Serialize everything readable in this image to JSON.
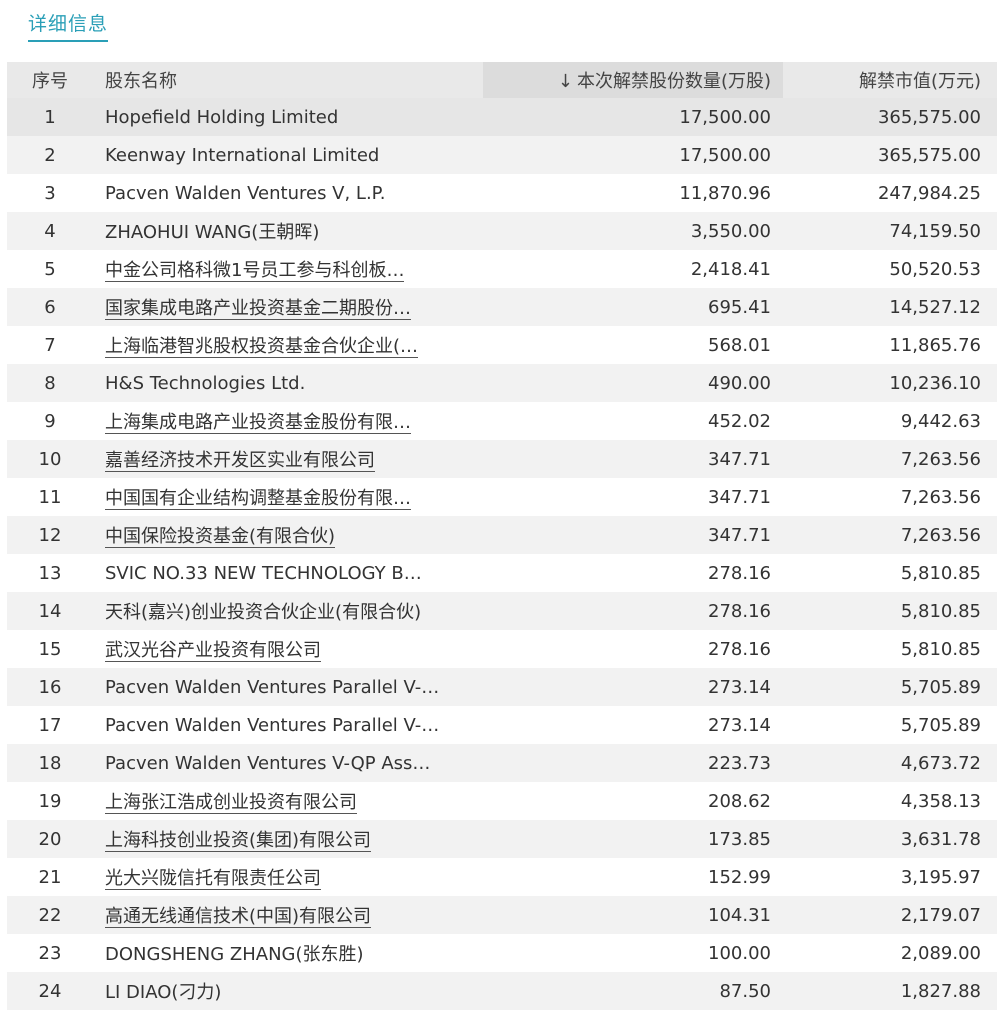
{
  "tab": {
    "label": "详细信息"
  },
  "table": {
    "headers": {
      "index": "序号",
      "holder": "股东名称",
      "sort_arrow": "↓",
      "shares": "本次解禁股份数量(万股)",
      "value": "解禁市值(万元)"
    },
    "rows": [
      {
        "idx": "1",
        "name": "Hopefield Holding Limited",
        "link": false,
        "shares": "17,500.00",
        "value": "365,575.00"
      },
      {
        "idx": "2",
        "name": "Keenway International Limited",
        "link": false,
        "shares": "17,500.00",
        "value": "365,575.00"
      },
      {
        "idx": "3",
        "name": "Pacven Walden Ventures V, L.P.",
        "link": false,
        "shares": "11,870.96",
        "value": "247,984.25"
      },
      {
        "idx": "4",
        "name": "ZHAOHUI WANG(王朝晖)",
        "link": false,
        "shares": "3,550.00",
        "value": "74,159.50"
      },
      {
        "idx": "5",
        "name": "中金公司格科微1号员工参与科创板…",
        "link": true,
        "shares": "2,418.41",
        "value": "50,520.53"
      },
      {
        "idx": "6",
        "name": "国家集成电路产业投资基金二期股份…",
        "link": true,
        "shares": "695.41",
        "value": "14,527.12"
      },
      {
        "idx": "7",
        "name": "上海临港智兆股权投资基金合伙企业(…",
        "link": true,
        "shares": "568.01",
        "value": "11,865.76"
      },
      {
        "idx": "8",
        "name": "H&S Technologies Ltd.",
        "link": false,
        "shares": "490.00",
        "value": "10,236.10"
      },
      {
        "idx": "9",
        "name": "上海集成电路产业投资基金股份有限…",
        "link": true,
        "shares": "452.02",
        "value": "9,442.63"
      },
      {
        "idx": "10",
        "name": "嘉善经济技术开发区实业有限公司",
        "link": true,
        "shares": "347.71",
        "value": "7,263.56"
      },
      {
        "idx": "11",
        "name": "中国国有企业结构调整基金股份有限…",
        "link": true,
        "shares": "347.71",
        "value": "7,263.56"
      },
      {
        "idx": "12",
        "name": "中国保险投资基金(有限合伙)",
        "link": true,
        "shares": "347.71",
        "value": "7,263.56"
      },
      {
        "idx": "13",
        "name": "SVIC NO.33 NEW TECHNOLOGY B…",
        "link": false,
        "shares": "278.16",
        "value": "5,810.85"
      },
      {
        "idx": "14",
        "name": "天科(嘉兴)创业投资合伙企业(有限合伙)",
        "link": false,
        "shares": "278.16",
        "value": "5,810.85"
      },
      {
        "idx": "15",
        "name": "武汉光谷产业投资有限公司",
        "link": true,
        "shares": "278.16",
        "value": "5,810.85"
      },
      {
        "idx": "16",
        "name": "Pacven Walden Ventures Parallel V-…",
        "link": false,
        "shares": "273.14",
        "value": "5,705.89"
      },
      {
        "idx": "17",
        "name": "Pacven Walden Ventures Parallel V-…",
        "link": false,
        "shares": "273.14",
        "value": "5,705.89"
      },
      {
        "idx": "18",
        "name": "Pacven Walden Ventures V-QP Ass…",
        "link": false,
        "shares": "223.73",
        "value": "4,673.72"
      },
      {
        "idx": "19",
        "name": "上海张江浩成创业投资有限公司",
        "link": true,
        "shares": "208.62",
        "value": "4,358.13"
      },
      {
        "idx": "20",
        "name": "上海科技创业投资(集团)有限公司",
        "link": true,
        "shares": "173.85",
        "value": "3,631.78"
      },
      {
        "idx": "21",
        "name": "光大兴陇信托有限责任公司",
        "link": true,
        "shares": "152.99",
        "value": "3,195.97"
      },
      {
        "idx": "22",
        "name": "高通无线通信技术(中国)有限公司",
        "link": true,
        "shares": "104.31",
        "value": "2,179.07"
      },
      {
        "idx": "23",
        "name": "DONGSHENG ZHANG(张东胜)",
        "link": false,
        "shares": "100.00",
        "value": "2,089.00"
      },
      {
        "idx": "24",
        "name": "LI DIAO(刁力)",
        "link": false,
        "shares": "87.50",
        "value": "1,827.88"
      }
    ]
  }
}
